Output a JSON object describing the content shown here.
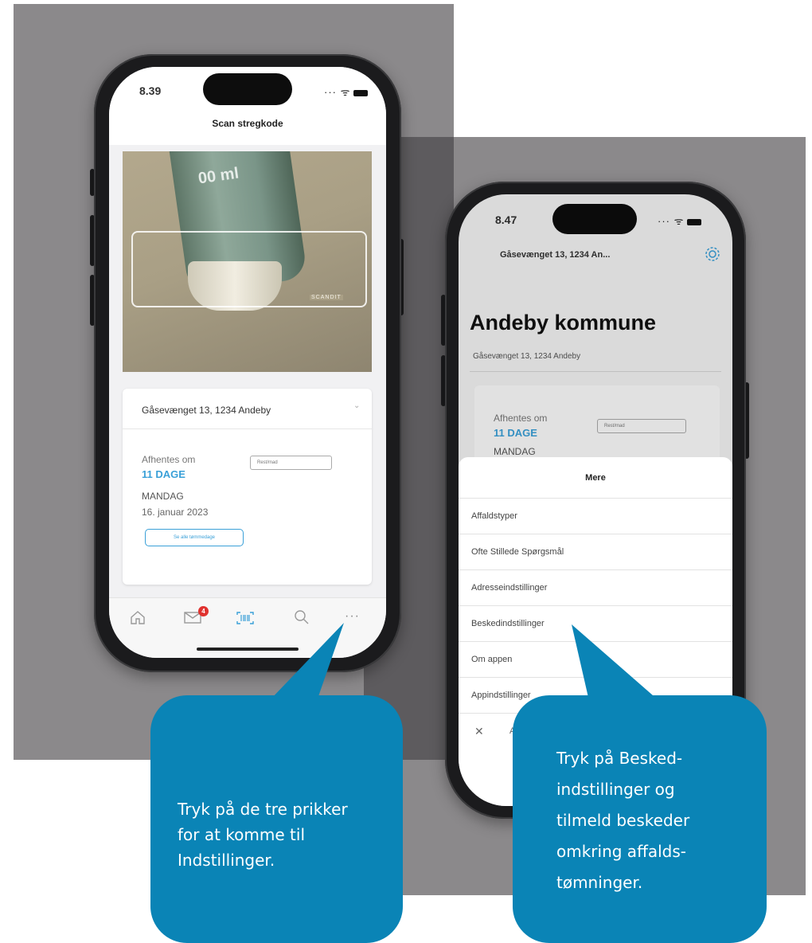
{
  "left_phone": {
    "status": {
      "time": "8.39"
    },
    "header": {
      "title": "Scan stregkode"
    },
    "camera": {
      "product_text_1": "00 ml",
      "scandit_label": "SCANDIT"
    },
    "address": {
      "selected": "Gåsevænget 13, 1234 Andeby"
    },
    "pickup": {
      "label": "Afhentes om",
      "days": "11 DAGE",
      "weekday": "MANDAG",
      "date": "16. januar 2023",
      "waste_type": "Rest/mad",
      "all_days_button": "Se alle tømmedage"
    },
    "tabbar": {
      "mail_badge": "4"
    }
  },
  "right_phone": {
    "status": {
      "time": "8.47"
    },
    "header": {
      "title": "Gåsevænget 13, 1234 An..."
    },
    "municipality": "Andeby kommune",
    "address": "Gåsevænget 13, 1234 Andeby",
    "pickup": {
      "label": "Afhentes om",
      "days": "11 DAGE",
      "weekday": "MANDAG",
      "waste_type": "Rest/mad"
    },
    "sheet": {
      "title": "Mere",
      "items": [
        "Affaldstyper",
        "Ofte Stillede Spørgsmål",
        "Adresseindstillinger",
        "Beskedindstillinger",
        "Om appen",
        "Appindstillinger"
      ],
      "close_text": "A"
    }
  },
  "callouts": {
    "left_lines": [
      "Tryk på de tre prikker",
      "for at komme til",
      "Indstillinger."
    ],
    "right_lines": [
      "Tryk på Besked-",
      "indstillinger og",
      "tilmeld beskeder",
      "omkring affalds-",
      "tømninger."
    ]
  },
  "colors": {
    "accent": "#3aa0d8",
    "callout": "#0a84b6",
    "backdrop": "#8b898b",
    "badge": "#e0322f"
  }
}
